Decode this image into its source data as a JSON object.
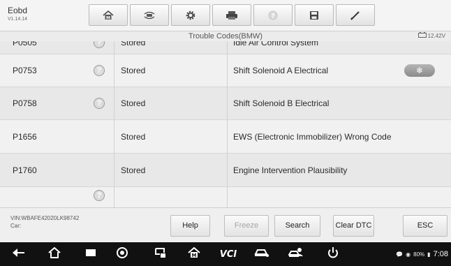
{
  "app": {
    "name": "Eobd",
    "version": "V1.14.14"
  },
  "title": "Trouble Codes(BMW)",
  "voltage": "12.42V",
  "rows": [
    {
      "code": "P0505",
      "help": true,
      "status": "Stored",
      "description": "Idle Air Control System",
      "freeze_frame": false
    },
    {
      "code": "P0753",
      "help": true,
      "status": "Stored",
      "description": "Shift Solenoid A Electrical",
      "freeze_frame": true
    },
    {
      "code": "P0758",
      "help": true,
      "status": "Stored",
      "description": "Shift Solenoid B Electrical",
      "freeze_frame": false
    },
    {
      "code": "P1656",
      "help": false,
      "status": "Stored",
      "description": "EWS (Electronic Immobilizer) Wrong Code",
      "freeze_frame": false
    },
    {
      "code": "P1760",
      "help": false,
      "status": "Stored",
      "description": "Engine Intervention Plausibility",
      "freeze_frame": false
    },
    {
      "code": "",
      "help": true,
      "status": "",
      "description": "",
      "freeze_frame": false
    }
  ],
  "vehicle": {
    "vin": "VIN:WBAFE42020LK98742",
    "car": "Car:"
  },
  "buttons": {
    "help": "Help",
    "freeze": "Freeze",
    "search": "Search",
    "clear_dtc": "Clear DTC",
    "esc": "ESC"
  },
  "toolbar_icons": [
    "home-icon",
    "vehicle-swap-icon",
    "settings-gear-icon",
    "printer-icon",
    "help-icon",
    "save-icon",
    "pen-icon"
  ],
  "status_bar": {
    "battery": "80%",
    "time": "7:08"
  },
  "colors": {
    "row_dark": "#e8e8e8",
    "row_light": "#f1f1f1",
    "navbar": "#111111",
    "freeze_badge": "#9c9c9c"
  }
}
